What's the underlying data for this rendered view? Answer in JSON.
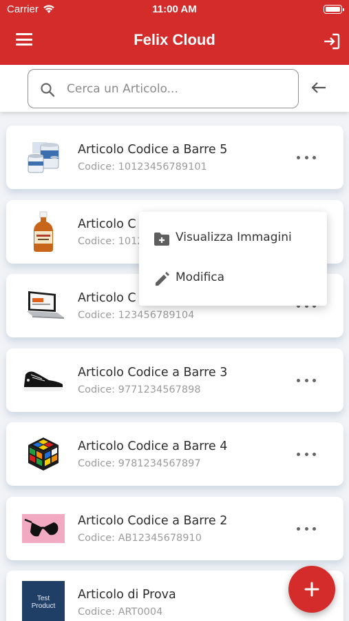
{
  "status_bar": {
    "carrier": "Carrier",
    "time": "11:00 AM"
  },
  "header": {
    "title": "Felix Cloud"
  },
  "search": {
    "placeholder": "Cerca un Articolo..."
  },
  "colors": {
    "brand": "#d42b2b",
    "background": "#f1f3f6"
  },
  "items": [
    {
      "name": "Articolo Codice a Barre 5",
      "code": "Codice: 10123456789101",
      "thumb": "paint-cans-icon"
    },
    {
      "name": "Articolo C",
      "code": "Codice: 1012",
      "thumb": "bottle-icon"
    },
    {
      "name": "Articolo C",
      "code": "Codice: 123456789104",
      "thumb": "laptop-icon"
    },
    {
      "name": "Articolo Codice a Barre 3",
      "code": "Codice: 9771234567898",
      "thumb": "sneaker-icon"
    },
    {
      "name": "Articolo Codice a Barre 4",
      "code": "Codice: 9781234567897",
      "thumb": "rubiks-cube-icon"
    },
    {
      "name": "Articolo Codice a Barre 2",
      "code": "Codice: AB12345678910",
      "thumb": "sunglasses-icon"
    },
    {
      "name": "Articolo di Prova",
      "code": "Codice: ART0004",
      "thumb": "test-product-icon",
      "thumb_text": "Test Product"
    }
  ],
  "menu": {
    "view_images": "Visualizza Immagini",
    "edit": "Modifica"
  }
}
